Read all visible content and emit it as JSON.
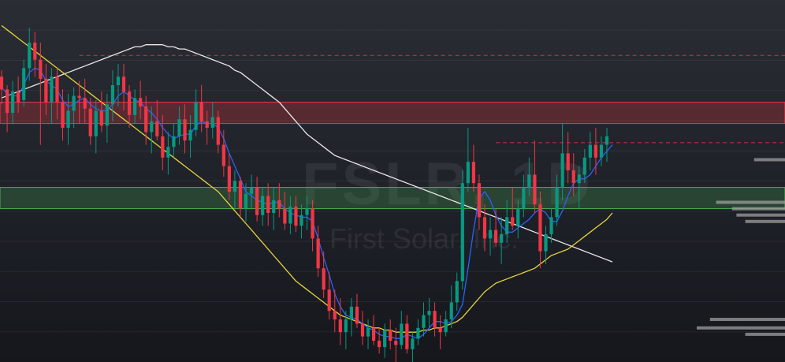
{
  "watermark": {
    "symbol": "FSLR, 1D",
    "company": "First Solar, Inc."
  },
  "colors": {
    "up": "#089981",
    "down": "#f23645",
    "ma_fast": "#2962ff",
    "ma_mid": "#e6d23c",
    "ma_slow": "#e8e8e8",
    "resistance": "#f23645",
    "support": "#4caf50",
    "volume_profile": "#9e9e9e"
  },
  "chart_data": {
    "type": "candlestick",
    "title": "",
    "price_range": [
      88,
      258
    ],
    "candles": [
      [
        222,
        225,
        209,
        216
      ],
      [
        216,
        218,
        196,
        205
      ],
      [
        205,
        220,
        200,
        215
      ],
      [
        215,
        222,
        205,
        210
      ],
      [
        211,
        230,
        208,
        226
      ],
      [
        226,
        245,
        220,
        238
      ],
      [
        238,
        243,
        222,
        230
      ],
      [
        230,
        238,
        190,
        221
      ],
      [
        221,
        228,
        204,
        210
      ],
      [
        210,
        226,
        200,
        222
      ],
      [
        222,
        226,
        202,
        210
      ],
      [
        210,
        216,
        192,
        198
      ],
      [
        198,
        214,
        190,
        206
      ],
      [
        206,
        217,
        198,
        213
      ],
      [
        213,
        220,
        200,
        212
      ],
      [
        212,
        221,
        200,
        207
      ],
      [
        207,
        212,
        190,
        194
      ],
      [
        194,
        211,
        186,
        206
      ],
      [
        206,
        215,
        196,
        199
      ],
      [
        199,
        214,
        191,
        209
      ],
      [
        209,
        225,
        201,
        218
      ],
      [
        218,
        228,
        208,
        222
      ],
      [
        222,
        228,
        206,
        215
      ],
      [
        215,
        218,
        198,
        204
      ],
      [
        204,
        216,
        200,
        212
      ],
      [
        212,
        220,
        202,
        208
      ],
      [
        208,
        213,
        190,
        196
      ],
      [
        196,
        208,
        186,
        201
      ],
      [
        201,
        211,
        192,
        194
      ],
      [
        194,
        204,
        178,
        184
      ],
      [
        184,
        196,
        176,
        189
      ],
      [
        189,
        200,
        184,
        194
      ],
      [
        194,
        208,
        190,
        202
      ],
      [
        202,
        209,
        186,
        192
      ],
      [
        192,
        204,
        184,
        197
      ],
      [
        197,
        216,
        194,
        210
      ],
      [
        210,
        218,
        196,
        201
      ],
      [
        201,
        206,
        190,
        198
      ],
      [
        198,
        210,
        193,
        203
      ],
      [
        203,
        206,
        186,
        190
      ],
      [
        190,
        197,
        175,
        180
      ],
      [
        180,
        186,
        164,
        168
      ],
      [
        168,
        178,
        160,
        173
      ],
      [
        173,
        175,
        156,
        160
      ],
      [
        160,
        172,
        154,
        167
      ],
      [
        167,
        176,
        160,
        170
      ],
      [
        170,
        175,
        154,
        157
      ],
      [
        157,
        170,
        152,
        166
      ],
      [
        166,
        172,
        152,
        158
      ],
      [
        158,
        170,
        150,
        164
      ],
      [
        164,
        172,
        156,
        160
      ],
      [
        160,
        168,
        150,
        153
      ],
      [
        153,
        166,
        148,
        161
      ],
      [
        161,
        166,
        149,
        152
      ],
      [
        152,
        162,
        146,
        157
      ],
      [
        157,
        166,
        150,
        160
      ],
      [
        160,
        164,
        140,
        146
      ],
      [
        146,
        152,
        128,
        132
      ],
      [
        132,
        140,
        118,
        122
      ],
      [
        122,
        130,
        108,
        112
      ],
      [
        112,
        122,
        102,
        108
      ],
      [
        108,
        118,
        96,
        102
      ],
      [
        102,
        112,
        94,
        108
      ],
      [
        108,
        118,
        100,
        114
      ],
      [
        114,
        120,
        104,
        106
      ],
      [
        106,
        112,
        96,
        100
      ],
      [
        100,
        108,
        94,
        104
      ],
      [
        104,
        110,
        96,
        98
      ],
      [
        98,
        104,
        92,
        95
      ],
      [
        95,
        106,
        90,
        103
      ],
      [
        103,
        108,
        94,
        98
      ],
      [
        98,
        104,
        88,
        96
      ],
      [
        96,
        112,
        94,
        106
      ],
      [
        106,
        110,
        92,
        94
      ],
      [
        94,
        102,
        88,
        99
      ],
      [
        99,
        108,
        96,
        104
      ],
      [
        104,
        116,
        100,
        110
      ],
      [
        110,
        118,
        104,
        112
      ],
      [
        112,
        116,
        100,
        104
      ],
      [
        104,
        110,
        94,
        102
      ],
      [
        102,
        112,
        100,
        108
      ],
      [
        108,
        124,
        104,
        116
      ],
      [
        116,
        130,
        112,
        126
      ],
      [
        126,
        178,
        122,
        172
      ],
      [
        172,
        198,
        168,
        182
      ],
      [
        182,
        190,
        168,
        172
      ],
      [
        172,
        176,
        150,
        156
      ],
      [
        156,
        162,
        140,
        146
      ],
      [
        146,
        156,
        138,
        150
      ],
      [
        150,
        160,
        142,
        144
      ],
      [
        144,
        156,
        134,
        148
      ],
      [
        148,
        164,
        144,
        156
      ],
      [
        156,
        170,
        150,
        152
      ],
      [
        152,
        164,
        146,
        160
      ],
      [
        160,
        176,
        156,
        170
      ],
      [
        170,
        184,
        166,
        176
      ],
      [
        176,
        192,
        158,
        162
      ],
      [
        162,
        168,
        132,
        140
      ],
      [
        140,
        152,
        134,
        148
      ],
      [
        148,
        160,
        144,
        156
      ],
      [
        156,
        176,
        152,
        170
      ],
      [
        170,
        200,
        164,
        186
      ],
      [
        186,
        196,
        172,
        178
      ],
      [
        178,
        186,
        166,
        172
      ],
      [
        172,
        180,
        160,
        176
      ],
      [
        176,
        188,
        172,
        184
      ],
      [
        184,
        196,
        178,
        190
      ],
      [
        190,
        198,
        176,
        184
      ],
      [
        184,
        194,
        180,
        190
      ],
      [
        190,
        198,
        182,
        194
      ]
    ],
    "ma_fast": [
      217,
      214,
      213,
      213,
      218,
      224,
      226,
      225,
      220,
      218,
      216,
      211,
      208,
      209,
      211,
      212,
      209,
      207,
      206,
      206,
      209,
      213,
      215,
      213,
      211,
      210,
      207,
      205,
      202,
      198,
      195,
      193,
      194,
      195,
      195,
      199,
      201,
      200,
      200,
      198,
      193,
      186,
      180,
      174,
      168,
      166,
      164,
      163,
      162,
      163,
      163,
      160,
      158,
      157,
      156,
      156,
      154,
      146,
      137,
      129,
      120,
      114,
      110,
      109,
      108,
      106,
      104,
      103,
      101,
      100,
      100,
      99,
      99,
      101,
      100,
      99,
      101,
      104,
      107,
      107,
      106,
      107,
      110,
      115,
      132,
      150,
      165,
      168,
      164,
      157,
      152,
      149,
      149,
      151,
      153,
      155,
      158,
      160,
      158,
      154,
      154,
      159,
      166,
      172,
      174,
      174,
      176,
      180,
      184,
      187,
      190
    ],
    "ma_mid": [
      246,
      244,
      242,
      240,
      238,
      236,
      234,
      232,
      230,
      228,
      226,
      224,
      222,
      220,
      218,
      216,
      214,
      212,
      210,
      208,
      206,
      204,
      202,
      200,
      198,
      196,
      194,
      192,
      190,
      188,
      186,
      184,
      182,
      180,
      178,
      176,
      174,
      172,
      170,
      168,
      165,
      162,
      159,
      156,
      153,
      150,
      147,
      144,
      141,
      138,
      135,
      132,
      129,
      126,
      124,
      122,
      120,
      118,
      116,
      114,
      112,
      110,
      109,
      108,
      107,
      106,
      105,
      104,
      104,
      103,
      103,
      102,
      102,
      102,
      102,
      102,
      103,
      103,
      104,
      104,
      105,
      106,
      107,
      109,
      112,
      115,
      118,
      121,
      123,
      125,
      126,
      127,
      128,
      129,
      130,
      131,
      132,
      134,
      136,
      138,
      139,
      140,
      141,
      143,
      145,
      147,
      149,
      151,
      153,
      155,
      158
    ],
    "ma_slow": [
      212,
      213,
      214,
      215,
      216,
      217,
      218,
      219,
      220,
      221,
      222,
      223,
      224,
      225,
      226,
      227,
      228,
      229,
      230,
      231,
      232,
      233,
      234,
      235,
      236,
      236,
      237,
      237,
      237,
      237,
      236,
      236,
      235,
      235,
      234,
      233,
      232,
      231,
      230,
      229,
      228,
      227,
      225,
      224,
      222,
      220,
      218,
      216,
      214,
      212,
      210,
      207,
      204,
      201,
      198,
      195,
      193,
      191,
      189,
      187,
      185,
      184,
      183,
      182,
      181,
      180,
      179,
      178,
      177,
      176,
      175,
      174,
      173,
      172,
      171,
      170,
      169,
      168,
      167,
      166,
      165,
      164,
      163,
      162,
      161,
      160,
      159,
      158,
      157,
      156,
      155,
      154,
      153,
      152,
      151,
      150,
      149,
      148,
      147,
      146,
      145,
      144,
      143,
      142,
      141,
      140,
      139,
      138,
      137,
      136,
      135
    ],
    "resistance_zone": [
      200,
      210
    ],
    "support_zone": [
      160,
      170
    ],
    "dashed_levels": [
      {
        "price": 232,
        "from_index": 14
      },
      {
        "price": 191,
        "from_index": 89
      }
    ],
    "volume_profile": [
      {
        "price": 183,
        "weight": 0.35
      },
      {
        "price": 163,
        "weight": 0.78
      },
      {
        "price": 160,
        "weight": 0.6
      },
      {
        "price": 157,
        "weight": 0.55
      },
      {
        "price": 154,
        "weight": 0.45
      },
      {
        "price": 108,
        "weight": 0.85
      },
      {
        "price": 104,
        "weight": 1.0
      },
      {
        "price": 101,
        "weight": 0.45
      }
    ]
  }
}
